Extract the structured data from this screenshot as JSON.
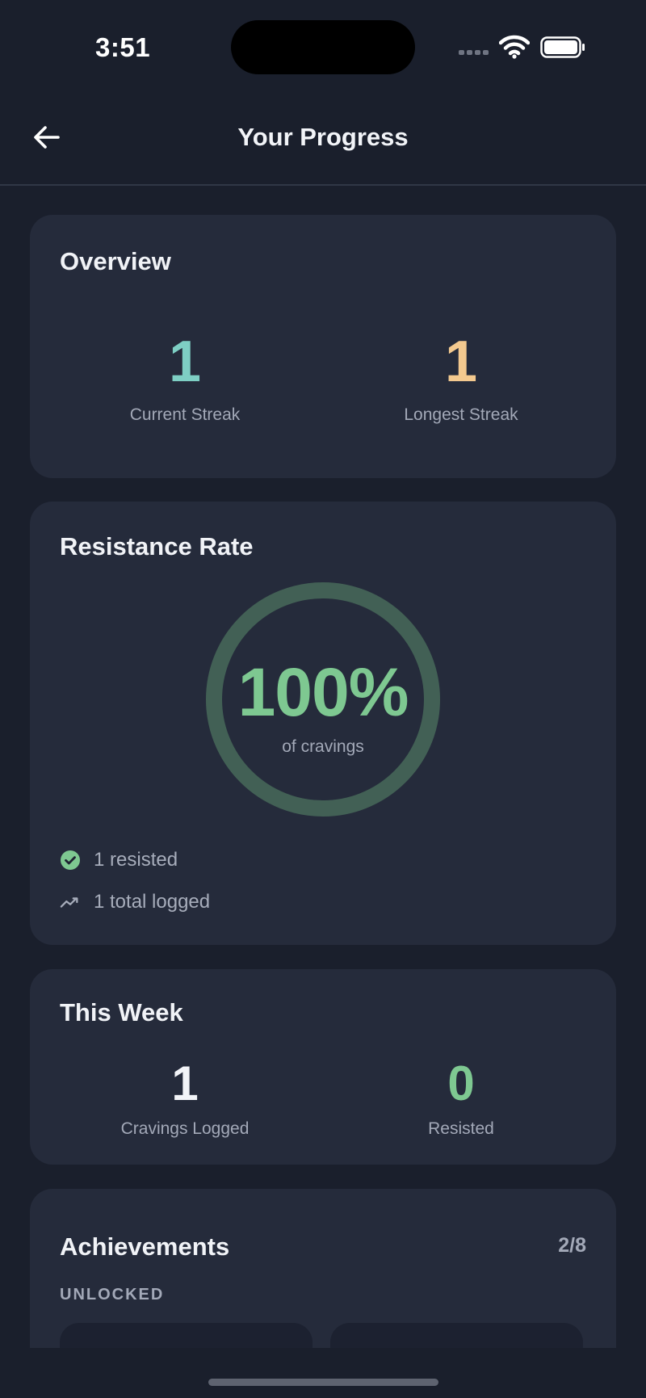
{
  "status_bar": {
    "time": "3:51",
    "icons": [
      "signal-icon",
      "wifi-icon",
      "battery-icon"
    ]
  },
  "header": {
    "title": "Your Progress",
    "back_icon": "arrow-left-icon"
  },
  "overview": {
    "title": "Overview",
    "current_streak": {
      "value": "1",
      "label": "Current Streak",
      "color": "#7ecfc4"
    },
    "longest_streak": {
      "value": "1",
      "label": "Longest Streak",
      "color": "#f3c98f"
    }
  },
  "resistance": {
    "title": "Resistance Rate",
    "percent_text": "100%",
    "percent_value": 100,
    "subtitle": "of cravings",
    "resisted": "1 resisted",
    "total_logged": "1 total logged",
    "accent": "#7ec891",
    "ring_track": "#354a48"
  },
  "this_week": {
    "title": "This Week",
    "cravings_logged": {
      "value": "1",
      "label": "Cravings Logged",
      "color": "#f2f4f8"
    },
    "resisted": {
      "value": "0",
      "label": "Resisted",
      "color": "#7ec891"
    }
  },
  "achievements": {
    "title": "Achievements",
    "count": "2/8",
    "section_label": "UNLOCKED"
  },
  "colors": {
    "background": "#1a1f2c",
    "card": "#252b3b",
    "muted_text": "#a3a9b8"
  }
}
